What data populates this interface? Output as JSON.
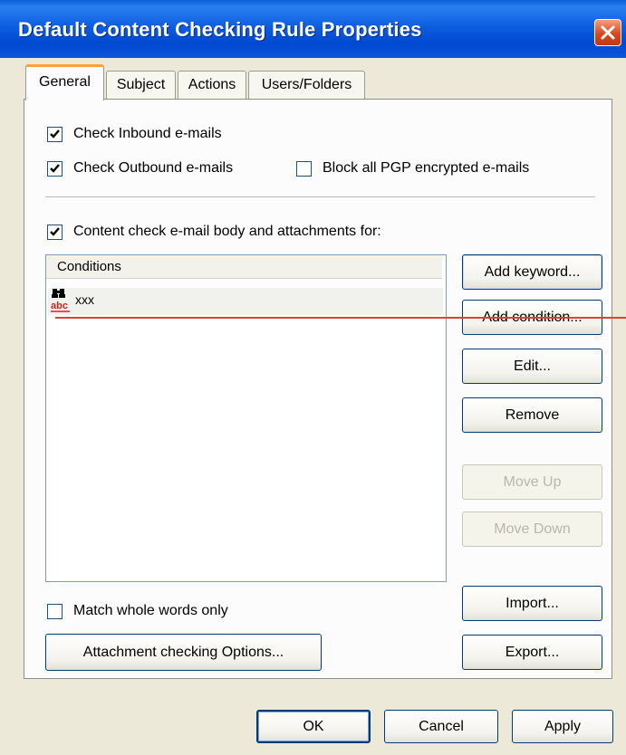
{
  "window": {
    "title": "Default Content Checking Rule Properties"
  },
  "tabs": [
    {
      "label": "General",
      "active": true
    },
    {
      "label": "Subject",
      "active": false
    },
    {
      "label": "Actions",
      "active": false
    },
    {
      "label": "Users/Folders",
      "active": false
    }
  ],
  "options": {
    "check_inbound": {
      "label": "Check Inbound e-mails",
      "checked": true
    },
    "check_outbound": {
      "label": "Check Outbound e-mails",
      "checked": true
    },
    "block_pgp": {
      "label": "Block all PGP encrypted e-mails",
      "checked": false
    },
    "content_check": {
      "label": "Content check e-mail body and attachments for:",
      "checked": true
    },
    "match_whole_words": {
      "label": "Match whole words only",
      "checked": false
    }
  },
  "conditions": {
    "header": "Conditions",
    "rows": [
      {
        "text": "xxx",
        "icon": "keyword-binoculars-icon"
      }
    ]
  },
  "side_buttons": {
    "add_keyword": "Add keyword...",
    "add_condition": "Add condition...",
    "edit": "Edit...",
    "remove": "Remove",
    "move_up": "Move Up",
    "move_down": "Move Down",
    "import": "Import...",
    "export": "Export..."
  },
  "attachment_button": "Attachment checking Options...",
  "footer": {
    "ok": "OK",
    "cancel": "Cancel",
    "apply": "Apply"
  },
  "colors": {
    "titlebar": "#0a55d8",
    "tab_accent": "#f7a33a",
    "annotation": "#d9442a"
  }
}
